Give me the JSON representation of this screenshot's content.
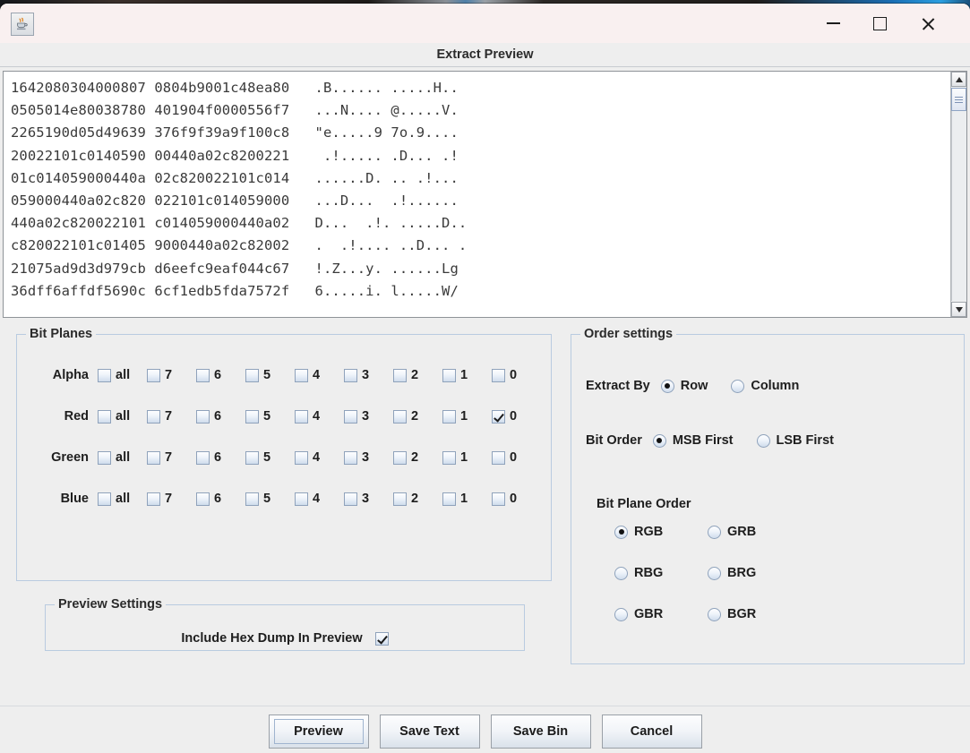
{
  "window": {
    "app_icon": "java-coffee-cup-icon",
    "minimize_label": "—",
    "maximize_label": "□",
    "close_label": "✕",
    "dialog_title": "Extract Preview"
  },
  "preview": {
    "hexdump": "1642080304000807 0804b9001c48ea80   .B...... .....H..\n0505014e80038780 401904f0000556f7   ...N.... @.....V.\n2265190d05d49639 376f9f39a9f100c8   \"e.....9 7o.9....\n20022101c0140590 00440a02c8200221    .!..... .D... .!\n01c014059000440a 02c820022101c014   ......D. .. .!...\n059000440a02c820 022101c014059000   ...D...  .!......\n440a02c820022101 c014059000440a02   D...  .!. .....D..\nc820022101c01405 9000440a02c82002   .  .!.... ..D... .\n21075ad9d3d979cb d6eefc9eaf044c67   !.Z...y. ......Lg\n36dff6affdf5690c 6cf1edb5fda7572f   6.....i. l.....W/",
    "scrollbar": {
      "up_arrow": "scroll-up-arrow-icon",
      "down_arrow": "scroll-down-arrow-icon"
    }
  },
  "bit_planes": {
    "title": "Bit Planes",
    "column_labels": [
      "all",
      "7",
      "6",
      "5",
      "4",
      "3",
      "2",
      "1",
      "0"
    ],
    "rows": [
      {
        "label": "Alpha",
        "checked": [
          false,
          false,
          false,
          false,
          false,
          false,
          false,
          false,
          false
        ]
      },
      {
        "label": "Red",
        "checked": [
          false,
          false,
          false,
          false,
          false,
          false,
          false,
          false,
          true
        ]
      },
      {
        "label": "Green",
        "checked": [
          false,
          false,
          false,
          false,
          false,
          false,
          false,
          false,
          false
        ]
      },
      {
        "label": "Blue",
        "checked": [
          false,
          false,
          false,
          false,
          false,
          false,
          false,
          false,
          false
        ]
      }
    ]
  },
  "preview_settings": {
    "title": "Preview Settings",
    "include_hex_dump_label": "Include Hex Dump In Preview",
    "include_hex_dump_checked": true
  },
  "order_settings": {
    "title": "Order settings",
    "extract_by": {
      "label": "Extract By",
      "options": [
        "Row",
        "Column"
      ],
      "selected": "Row"
    },
    "bit_order": {
      "label": "Bit Order",
      "options": [
        "MSB First",
        "LSB First"
      ],
      "selected": "MSB First"
    },
    "bit_plane_order": {
      "label": "Bit Plane Order",
      "options": [
        "RGB",
        "GRB",
        "RBG",
        "BRG",
        "GBR",
        "BGR"
      ],
      "selected": "RGB"
    }
  },
  "buttons": {
    "preview": "Preview",
    "save_text": "Save Text",
    "save_bin": "Save Bin",
    "cancel": "Cancel",
    "focused": "Preview"
  }
}
